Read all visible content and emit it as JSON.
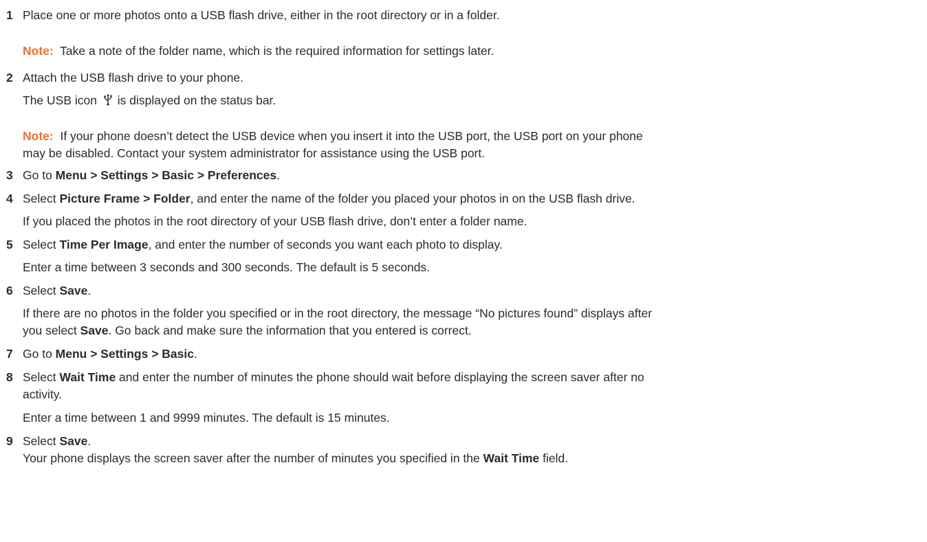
{
  "steps": {
    "s1": {
      "num": "1",
      "text": "Place one or more photos onto a USB flash drive, either in the root directory or in a folder."
    },
    "note1": {
      "label": "Note:",
      "text": "Take a note of the folder name, which is the required information for settings later."
    },
    "s2": {
      "num": "2",
      "text": "Attach the USB flash drive to your phone.",
      "sub_before": "The USB icon",
      "icon": "usb-icon",
      "sub_after": "is displayed on the status bar."
    },
    "note2": {
      "label": "Note:",
      "line1": "If your phone doesn’t detect the USB device when you insert it into the USB port, the USB port on your phone",
      "line2": "may be disabled. Contact your system administrator for assistance using the USB port."
    },
    "s3": {
      "num": "3",
      "pre": "Go to ",
      "bold": "Menu > Settings > Basic > Preferences",
      "post": "."
    },
    "s4": {
      "num": "4",
      "pre": "Select ",
      "bold": "Picture Frame > Folder",
      "post": ", and enter the name of the folder you placed your photos in on the USB flash drive.",
      "sub": "If you placed the photos in the root directory of your USB flash drive, don’t enter a folder name."
    },
    "s5": {
      "num": "5",
      "pre": "Select ",
      "bold": "Time Per Image",
      "post": ", and enter the number of seconds you want each photo to display.",
      "sub": "Enter a time between 3 seconds and 300 seconds. The default is 5 seconds."
    },
    "s6": {
      "num": "6",
      "pre": "Select ",
      "bold": "Save",
      "post": ".",
      "sub1": "If there are no photos in the folder you specified or in the root directory, the message “No pictures found” displays after",
      "sub2_pre": "you select ",
      "sub2_bold": "Save",
      "sub2_post": ". Go back and make sure the information that you entered is correct."
    },
    "s7": {
      "num": "7",
      "pre": "Go to ",
      "bold": "Menu > Settings > Basic",
      "post": "."
    },
    "s8": {
      "num": "8",
      "pre": "Select ",
      "bold": "Wait Time",
      "post": " and enter the number of minutes the phone should wait before displaying the screen saver after no",
      "line2": "activity.",
      "sub": "Enter a time between 1 and 9999 minutes. The default is 15 minutes."
    },
    "s9": {
      "num": "9",
      "pre": "Select ",
      "bold": "Save",
      "post": ".",
      "sub_pre": "Your phone displays the screen saver after the number of minutes you specified in the ",
      "sub_bold": "Wait Time",
      "sub_post": " field."
    }
  },
  "colors": {
    "note_label": "#e8702a",
    "text": "#2b2b2b"
  }
}
